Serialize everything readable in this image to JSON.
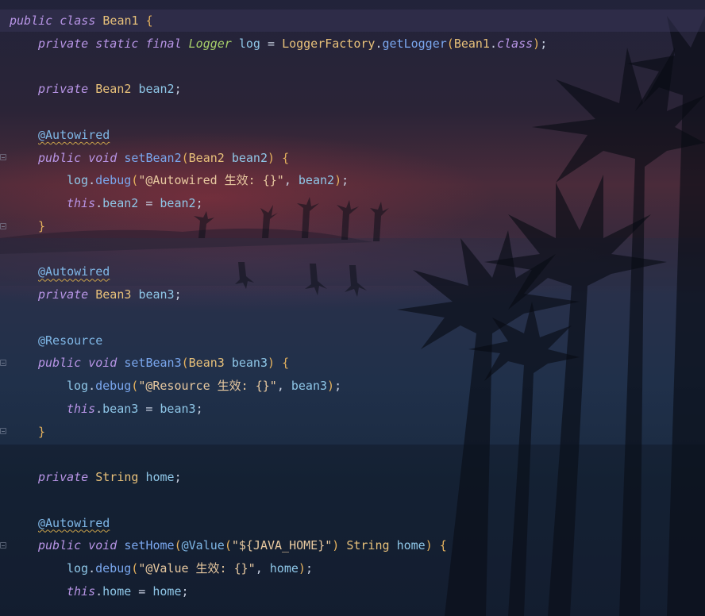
{
  "editor": {
    "lines": [
      "public class Bean1 {",
      "    private static final Logger log = LoggerFactory.getLogger(Bean1.class);",
      "",
      "    private Bean2 bean2;",
      "",
      "    @Autowired",
      "    public void setBean2(Bean2 bean2) {",
      "        log.debug(\"@Autowired 生效: {}\", bean2);",
      "        this.bean2 = bean2;",
      "    }",
      "",
      "    @Autowired",
      "    private Bean3 bean3;",
      "",
      "    @Resource",
      "    public void setBean3(Bean3 bean3) {",
      "        log.debug(\"@Resource 生效: {}\", bean3);",
      "        this.bean3 = bean3;",
      "    }",
      "",
      "    private String home;",
      "",
      "    @Autowired",
      "    public void setHome(@Value(\"${JAVA_HOME}\") String home) {",
      "        log.debug(\"@Value 生效: {}\", home);",
      "        this.home = home;"
    ],
    "t": {
      "public": "public",
      "private": "private",
      "static": "static",
      "final": "final",
      "class": "class",
      "void": "void",
      "this": "this",
      "class_lit": "class",
      "Bean1": "Bean1",
      "Bean2": "Bean2",
      "Bean3": "Bean3",
      "Logger": "Logger",
      "LoggerFactory": "LoggerFactory",
      "getLogger": "getLogger",
      "String": "String",
      "log": "log",
      "debug": "debug",
      "bean2": "bean2",
      "bean3": "bean3",
      "home": "home",
      "setBean2": "setBean2",
      "setBean3": "setBean3",
      "setHome": "setHome",
      "Autowired": "@Autowired",
      "Resource": "@Resource",
      "Value": "@Value",
      "str_autowired": "\"@Autowired 生效: {}\"",
      "str_resource": "\"@Resource 生效: {}\"",
      "str_value": "\"@Value 生效: {}\"",
      "str_javahome": "\"${JAVA_HOME}\"",
      "lbrace": "{",
      "rbrace": "}",
      "lparen": "(",
      "rparen": ")",
      "dot": ".",
      "semi": ";",
      "eq": " = ",
      "comma": ", ",
      "space": " "
    }
  },
  "colors": {
    "keyword": "#b895e6",
    "type": "#e8c17a",
    "method": "#7aa7ee",
    "variable": "#8fc7e8",
    "string": "#e8c9a0",
    "annotation": "#7fb7e6",
    "warning_underline": "#c9a24a"
  }
}
